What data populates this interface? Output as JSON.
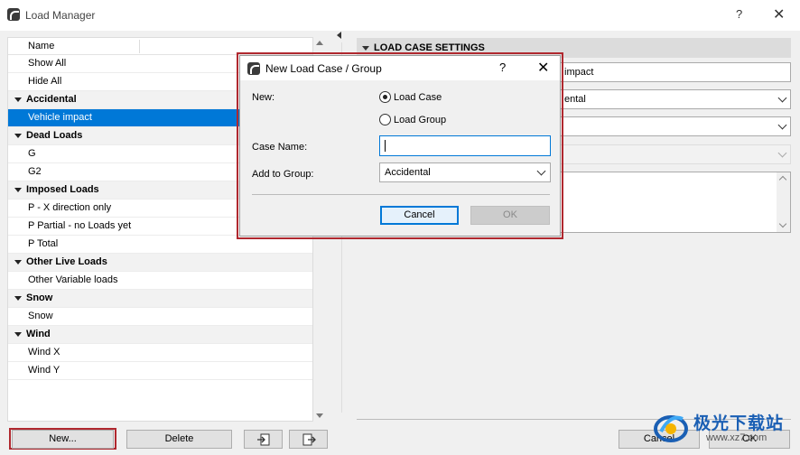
{
  "window": {
    "title": "Load Manager",
    "help": "?",
    "close": "✕"
  },
  "list": {
    "column_header": "Name",
    "rows": [
      {
        "label": "Show All",
        "type": "item"
      },
      {
        "label": "Hide All",
        "type": "item"
      },
      {
        "label": "Accidental",
        "type": "group"
      },
      {
        "label": "Vehicle impact",
        "type": "item",
        "selected": true
      },
      {
        "label": "Dead Loads",
        "type": "group"
      },
      {
        "label": "G",
        "type": "item"
      },
      {
        "label": "G2",
        "type": "item"
      },
      {
        "label": "Imposed Loads",
        "type": "group"
      },
      {
        "label": "P - X direction only",
        "type": "item"
      },
      {
        "label": "P Partial - no Loads yet",
        "type": "item"
      },
      {
        "label": "P Total",
        "type": "item"
      },
      {
        "label": "Other Live Loads",
        "type": "group"
      },
      {
        "label": "Other Variable loads",
        "type": "item"
      },
      {
        "label": "Snow",
        "type": "group"
      },
      {
        "label": "Snow",
        "type": "item"
      },
      {
        "label": "Wind",
        "type": "group"
      },
      {
        "label": "Wind X",
        "type": "item"
      },
      {
        "label": "Wind Y",
        "type": "item"
      }
    ]
  },
  "buttons": {
    "new": "New...",
    "delete": "Delete",
    "cancel": "Cancel",
    "ok": "OK"
  },
  "settings": {
    "header": "LOAD CASE SETTINGS",
    "name_value": "impact",
    "group_value": "ental"
  },
  "modal": {
    "title": "New Load Case / Group",
    "help": "?",
    "close": "✕",
    "new_label": "New:",
    "option_case": "Load Case",
    "option_group": "Load Group",
    "case_name_label": "Case Name:",
    "case_name_value": "",
    "add_to_group_label": "Add to Group:",
    "add_to_group_value": "Accidental",
    "cancel": "Cancel",
    "ok": "OK"
  },
  "watermark": {
    "text": "极光下载站",
    "url": "www.xz7.com"
  }
}
